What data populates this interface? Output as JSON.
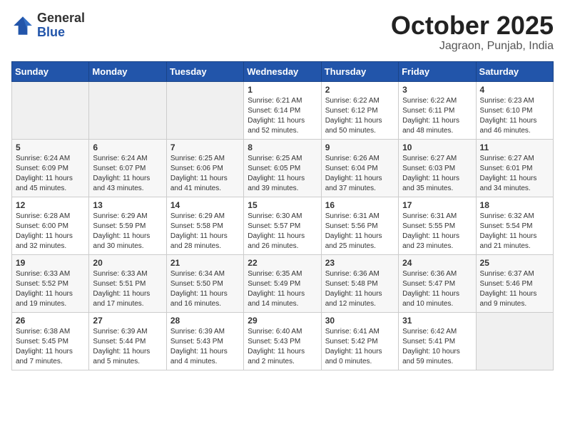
{
  "header": {
    "logo_general": "General",
    "logo_blue": "Blue",
    "month_title": "October 2025",
    "location": "Jagraon, Punjab, India"
  },
  "columns": [
    "Sunday",
    "Monday",
    "Tuesday",
    "Wednesday",
    "Thursday",
    "Friday",
    "Saturday"
  ],
  "weeks": [
    [
      {
        "day": "",
        "info": ""
      },
      {
        "day": "",
        "info": ""
      },
      {
        "day": "",
        "info": ""
      },
      {
        "day": "1",
        "info": "Sunrise: 6:21 AM\nSunset: 6:14 PM\nDaylight: 11 hours\nand 52 minutes."
      },
      {
        "day": "2",
        "info": "Sunrise: 6:22 AM\nSunset: 6:12 PM\nDaylight: 11 hours\nand 50 minutes."
      },
      {
        "day": "3",
        "info": "Sunrise: 6:22 AM\nSunset: 6:11 PM\nDaylight: 11 hours\nand 48 minutes."
      },
      {
        "day": "4",
        "info": "Sunrise: 6:23 AM\nSunset: 6:10 PM\nDaylight: 11 hours\nand 46 minutes."
      }
    ],
    [
      {
        "day": "5",
        "info": "Sunrise: 6:24 AM\nSunset: 6:09 PM\nDaylight: 11 hours\nand 45 minutes."
      },
      {
        "day": "6",
        "info": "Sunrise: 6:24 AM\nSunset: 6:07 PM\nDaylight: 11 hours\nand 43 minutes."
      },
      {
        "day": "7",
        "info": "Sunrise: 6:25 AM\nSunset: 6:06 PM\nDaylight: 11 hours\nand 41 minutes."
      },
      {
        "day": "8",
        "info": "Sunrise: 6:25 AM\nSunset: 6:05 PM\nDaylight: 11 hours\nand 39 minutes."
      },
      {
        "day": "9",
        "info": "Sunrise: 6:26 AM\nSunset: 6:04 PM\nDaylight: 11 hours\nand 37 minutes."
      },
      {
        "day": "10",
        "info": "Sunrise: 6:27 AM\nSunset: 6:03 PM\nDaylight: 11 hours\nand 35 minutes."
      },
      {
        "day": "11",
        "info": "Sunrise: 6:27 AM\nSunset: 6:01 PM\nDaylight: 11 hours\nand 34 minutes."
      }
    ],
    [
      {
        "day": "12",
        "info": "Sunrise: 6:28 AM\nSunset: 6:00 PM\nDaylight: 11 hours\nand 32 minutes."
      },
      {
        "day": "13",
        "info": "Sunrise: 6:29 AM\nSunset: 5:59 PM\nDaylight: 11 hours\nand 30 minutes."
      },
      {
        "day": "14",
        "info": "Sunrise: 6:29 AM\nSunset: 5:58 PM\nDaylight: 11 hours\nand 28 minutes."
      },
      {
        "day": "15",
        "info": "Sunrise: 6:30 AM\nSunset: 5:57 PM\nDaylight: 11 hours\nand 26 minutes."
      },
      {
        "day": "16",
        "info": "Sunrise: 6:31 AM\nSunset: 5:56 PM\nDaylight: 11 hours\nand 25 minutes."
      },
      {
        "day": "17",
        "info": "Sunrise: 6:31 AM\nSunset: 5:55 PM\nDaylight: 11 hours\nand 23 minutes."
      },
      {
        "day": "18",
        "info": "Sunrise: 6:32 AM\nSunset: 5:54 PM\nDaylight: 11 hours\nand 21 minutes."
      }
    ],
    [
      {
        "day": "19",
        "info": "Sunrise: 6:33 AM\nSunset: 5:52 PM\nDaylight: 11 hours\nand 19 minutes."
      },
      {
        "day": "20",
        "info": "Sunrise: 6:33 AM\nSunset: 5:51 PM\nDaylight: 11 hours\nand 17 minutes."
      },
      {
        "day": "21",
        "info": "Sunrise: 6:34 AM\nSunset: 5:50 PM\nDaylight: 11 hours\nand 16 minutes."
      },
      {
        "day": "22",
        "info": "Sunrise: 6:35 AM\nSunset: 5:49 PM\nDaylight: 11 hours\nand 14 minutes."
      },
      {
        "day": "23",
        "info": "Sunrise: 6:36 AM\nSunset: 5:48 PM\nDaylight: 11 hours\nand 12 minutes."
      },
      {
        "day": "24",
        "info": "Sunrise: 6:36 AM\nSunset: 5:47 PM\nDaylight: 11 hours\nand 10 minutes."
      },
      {
        "day": "25",
        "info": "Sunrise: 6:37 AM\nSunset: 5:46 PM\nDaylight: 11 hours\nand 9 minutes."
      }
    ],
    [
      {
        "day": "26",
        "info": "Sunrise: 6:38 AM\nSunset: 5:45 PM\nDaylight: 11 hours\nand 7 minutes."
      },
      {
        "day": "27",
        "info": "Sunrise: 6:39 AM\nSunset: 5:44 PM\nDaylight: 11 hours\nand 5 minutes."
      },
      {
        "day": "28",
        "info": "Sunrise: 6:39 AM\nSunset: 5:43 PM\nDaylight: 11 hours\nand 4 minutes."
      },
      {
        "day": "29",
        "info": "Sunrise: 6:40 AM\nSunset: 5:43 PM\nDaylight: 11 hours\nand 2 minutes."
      },
      {
        "day": "30",
        "info": "Sunrise: 6:41 AM\nSunset: 5:42 PM\nDaylight: 11 hours\nand 0 minutes."
      },
      {
        "day": "31",
        "info": "Sunrise: 6:42 AM\nSunset: 5:41 PM\nDaylight: 10 hours\nand 59 minutes."
      },
      {
        "day": "",
        "info": ""
      }
    ]
  ]
}
